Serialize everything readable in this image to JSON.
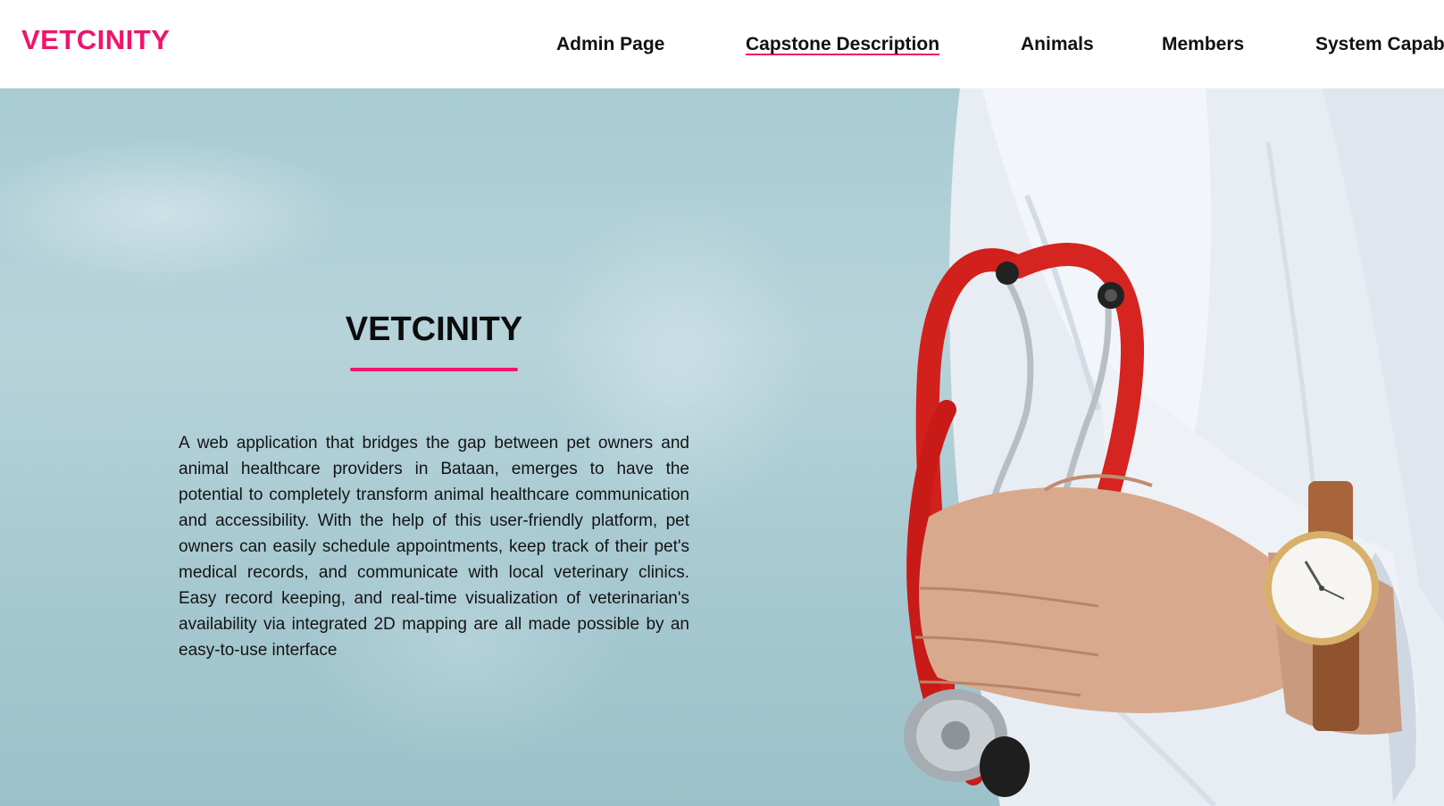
{
  "header": {
    "brand": "VETCINITY",
    "nav": [
      {
        "label": "Admin Page",
        "active": false
      },
      {
        "label": "Capstone Description",
        "active": true
      },
      {
        "label": "Animals",
        "active": false
      },
      {
        "label": "Members",
        "active": false
      },
      {
        "label": "System Capabilities",
        "active": false
      }
    ]
  },
  "hero": {
    "title": "VETCINITY",
    "description": "A web application that bridges the gap between pet owners and animal healthcare providers in Bataan, emerges to have the potential to completely transform animal healthcare communication and accessibility. With the help of this user-friendly platform, pet owners can easily schedule appointments, keep track of their pet's medical records, and communicate with local veterinary clinics. Easy record keeping, and real-time visualization of veterinarian's availability via integrated 2D mapping are all made possible by an easy-to-use interface",
    "image": {
      "subject": "veterinarian-with-stethoscope-and-wristwatch"
    }
  },
  "colors": {
    "accent": "#f0146c",
    "text": "#111111",
    "hero_bg": "#a9cbd3"
  }
}
